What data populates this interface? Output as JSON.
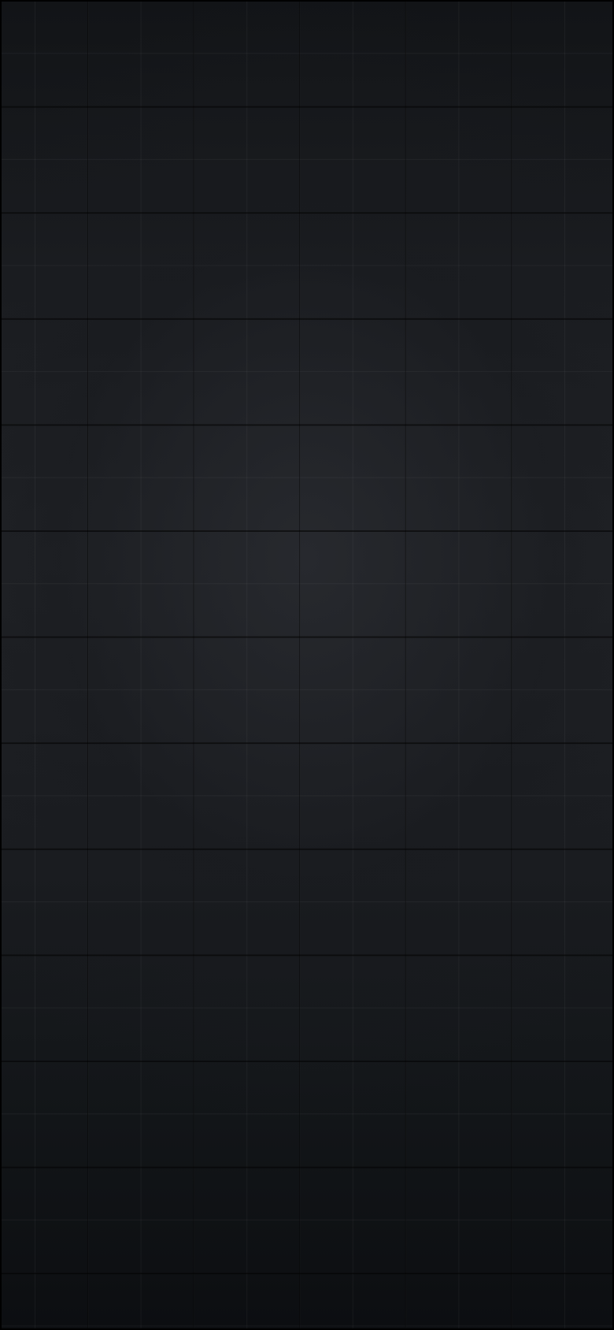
{
  "screen": {
    "background_color": "#1e2024",
    "grid_line_color": "#000000",
    "texture": "grid-pattern"
  }
}
